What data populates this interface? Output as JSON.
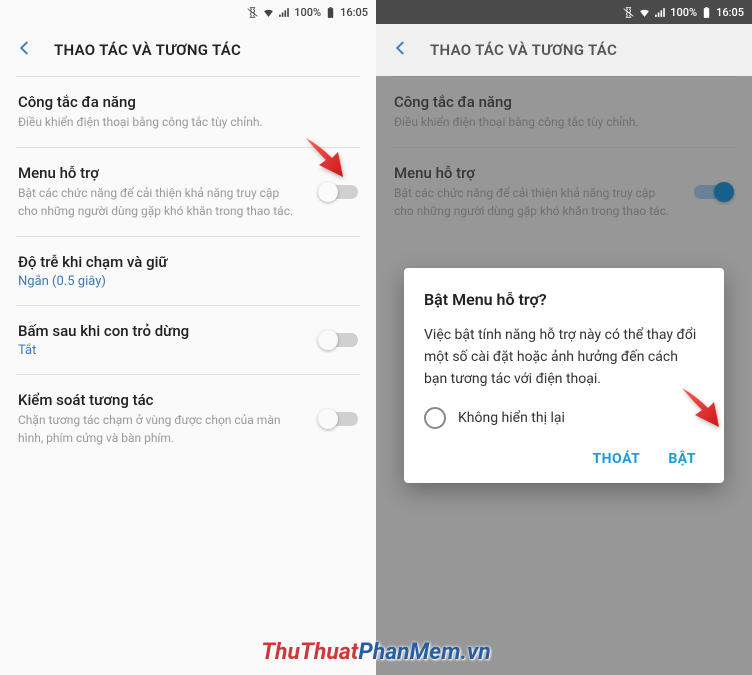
{
  "statusbar": {
    "battery": "100%",
    "time": "16:05"
  },
  "header": {
    "title": "THAO TÁC VÀ TƯƠNG TÁC"
  },
  "rows": {
    "universal": {
      "title": "Công tắc đa năng",
      "desc": "Điều khiển điện thoại bằng công tắc tùy chỉnh."
    },
    "assist": {
      "title": "Menu hỗ trợ",
      "desc": "Bật các chức năng để cải thiện khả năng truy cập cho những người dùng gặp khó khăn trong thao tác."
    },
    "touchhold": {
      "title": "Độ trễ khi chạm và giữ",
      "value": "Ngắn (0.5 giây)"
    },
    "taphover": {
      "title": "Bấm sau khi con trỏ dừng",
      "value": "Tắt"
    },
    "interaction": {
      "title": "Kiểm soát tương tác",
      "desc": "Chặn tương tác chạm ở vùng được chọn của màn hình, phím cứng và bàn phím."
    }
  },
  "dialog": {
    "title": "Bật Menu hỗ trợ?",
    "body": "Việc bật tính năng hỗ trợ này có thể thay đổi một số cài đặt hoặc ảnh hưởng đến cách bạn tương tác với điện thoại.",
    "checkbox": "Không hiển thị lại",
    "cancel": "THOÁT",
    "ok": "BẬT"
  },
  "watermark": {
    "part1": "ThuThuat",
    "part2": "PhanMem.vn"
  }
}
